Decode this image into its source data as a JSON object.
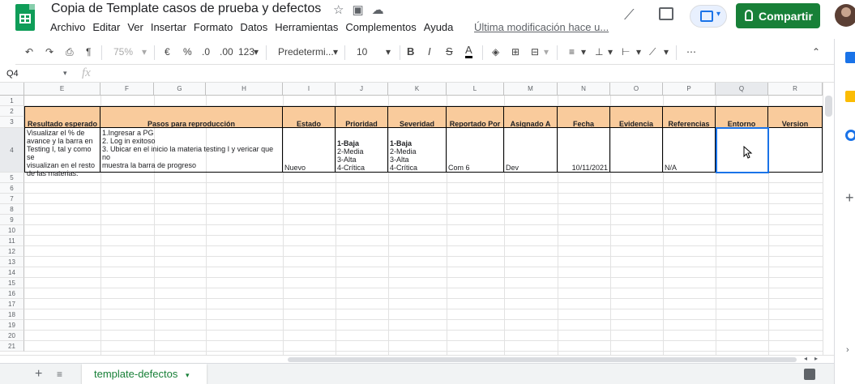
{
  "doc": {
    "title": "Copia de Template casos de prueba y defectos",
    "last_modified": "Última modificación hace u...",
    "share_label": "Compartir"
  },
  "menu": [
    "Archivo",
    "Editar",
    "Ver",
    "Insertar",
    "Formato",
    "Datos",
    "Herramientas",
    "Complementos",
    "Ayuda"
  ],
  "toolbar": {
    "zoom": "75%",
    "currency": "€",
    "percent": "%",
    "dec_less": ".0",
    "dec_more": ".00",
    "more_formats": "123",
    "font": "Predetermi...",
    "font_size": "10",
    "bold": "B",
    "italic": "I",
    "strike": "S",
    "text_color": "A"
  },
  "namebox": "Q4",
  "fx": "fx",
  "columns": [
    "E",
    "F",
    "G",
    "H",
    "I",
    "J",
    "K",
    "L",
    "M",
    "N",
    "O",
    "P",
    "Q",
    "R"
  ],
  "rows": [
    "1",
    "2",
    "3",
    "4",
    "5",
    "6",
    "7",
    "8",
    "9",
    "10",
    "11",
    "12",
    "13",
    "14",
    "15",
    "16",
    "17",
    "18",
    "19",
    "20",
    "21"
  ],
  "headers": {
    "resultado": "Resultado esperado",
    "pasos": "Pasos para reproducción",
    "estado": "Estado",
    "prioridad": "Prioridad",
    "severidad": "Severidad",
    "reportado": "Reportado Por",
    "asignado": "Asignado A",
    "fecha": "Fecha",
    "evidencia": "Evidencia",
    "referencias": "Referencias",
    "entorno": "Entorno",
    "version": "Version"
  },
  "row4": {
    "resultado_l1": "Visualizar el % de",
    "resultado_l2": "avance y la barra en",
    "resultado_l3": "Testing I, tal y como se",
    "resultado_l4": "visualizan en el resto",
    "resultado_l5": "de las materias.",
    "pasos_l1": "1.Ingresar a PG",
    "pasos_l2": "2. Log in exitoso",
    "pasos_l3": "3. Ubicar en el inicio la materia testing I y vericar que no",
    "pasos_l4": "muestra la barra de progreso",
    "estado": "Nuevo",
    "prioridad_l1": "1-Baja",
    "prioridad_l2": "2-Media",
    "prioridad_l3": "3-Alta",
    "prioridad_l4": "4-Crítica",
    "severidad_l1": "1-Baja",
    "severidad_l2": "2-Media",
    "severidad_l3": "3-Alta",
    "severidad_l4": "4-Crítica",
    "reportado": "Com 6",
    "asignado": "Dev",
    "fecha": "10/11/2021",
    "referencias": "N/A"
  },
  "sheet_tab": "template-defectos"
}
